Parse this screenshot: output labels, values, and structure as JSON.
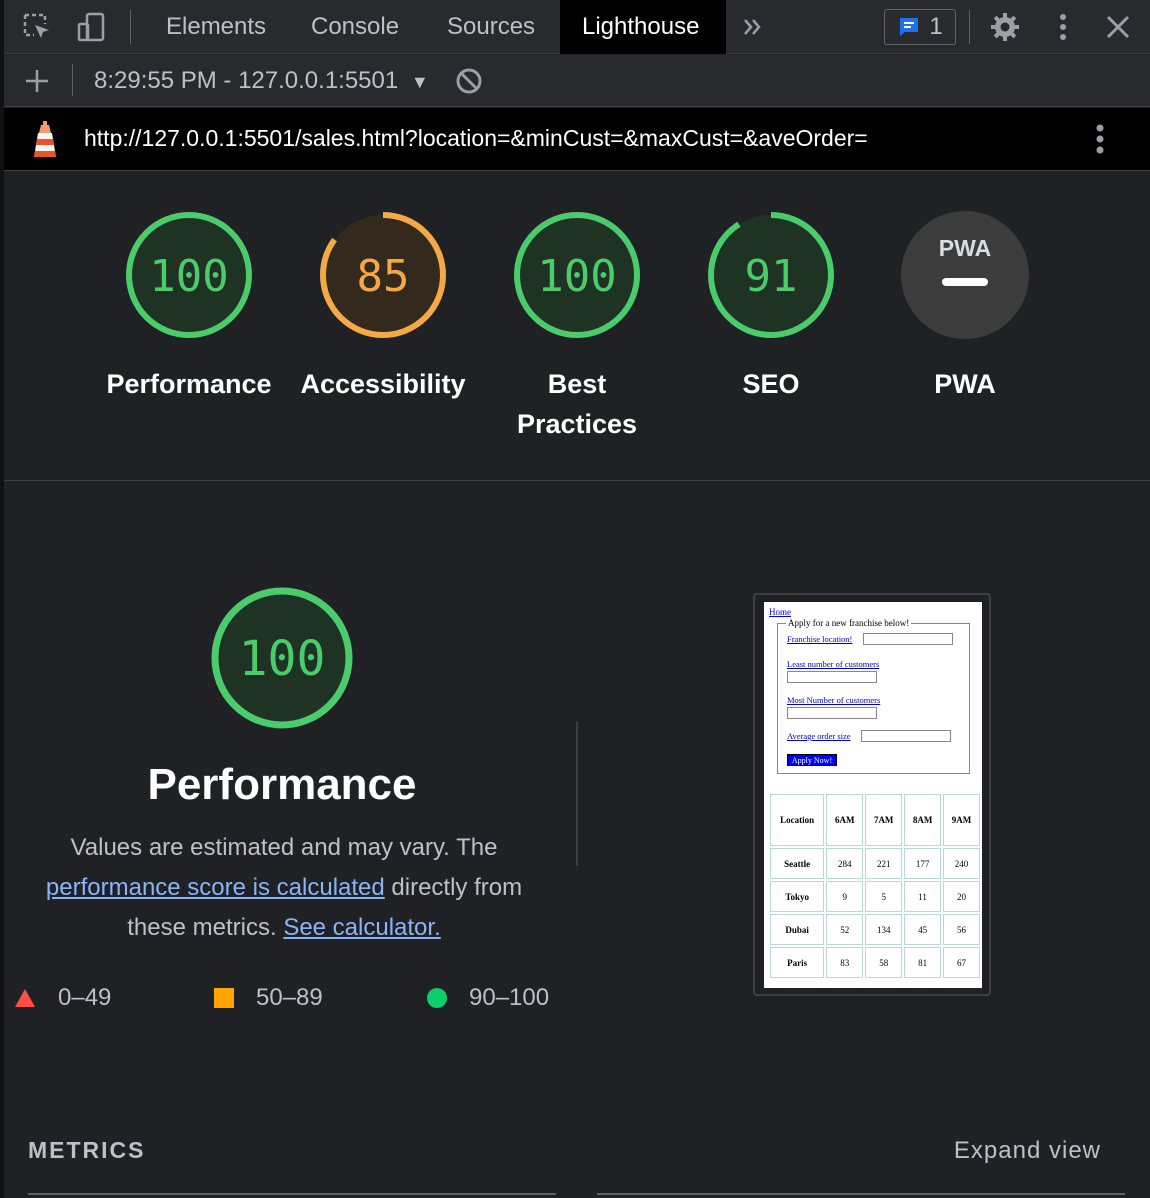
{
  "devtools": {
    "tabs": [
      "Elements",
      "Console",
      "Sources",
      "Lighthouse"
    ],
    "active_tab": "Lighthouse",
    "message_count": "1"
  },
  "report_toolbar": {
    "report_label": "8:29:55 PM - 127.0.0.1:5501"
  },
  "url_bar": {
    "url": "http://127.0.0.1:5501/sales.html?location=&minCust=&maxCust=&aveOrder="
  },
  "gauges": [
    {
      "score": "100",
      "label": "Performance",
      "value": 100,
      "color": "#4bcc6b"
    },
    {
      "score": "85",
      "label": "Accessibility",
      "value": 85,
      "color": "#f4a946"
    },
    {
      "score": "100",
      "label": "Best Practices",
      "value": 100,
      "color": "#4bcc6b"
    },
    {
      "score": "91",
      "label": "SEO",
      "value": 91,
      "color": "#4bcc6b"
    },
    {
      "score": "PWA",
      "label": "PWA",
      "value": null,
      "color": "#3c3c3c"
    }
  ],
  "performance": {
    "score": "100",
    "title": "Performance",
    "desc_before": "Values are estimated and may vary. The",
    "link1": "performance score is calculated",
    "desc_middle": "directly from these metrics.",
    "link2": "See calculator."
  },
  "legend": [
    {
      "range": "0–49",
      "color": "#ff4e42"
    },
    {
      "range": "50–89",
      "color": "#ffa400"
    },
    {
      "range": "90–100",
      "color": "#0cce6b"
    }
  ],
  "screenshot": {
    "home_link": "Home",
    "legend": "Apply for a new franchise below!",
    "fields": [
      "Franchise location!",
      "Least number of customers",
      "Most Number of customers",
      "Average order size"
    ],
    "button": "Apply Now!",
    "table_headers": [
      "Location",
      "6AM",
      "7AM",
      "8AM",
      "9AM"
    ],
    "table_rows": [
      [
        "Seattle",
        "284",
        "221",
        "177",
        "240"
      ],
      [
        "Tokyo",
        "9",
        "5",
        "11",
        "20"
      ],
      [
        "Dubai",
        "52",
        "134",
        "45",
        "56"
      ],
      [
        "Paris",
        "83",
        "58",
        "81",
        "67"
      ]
    ]
  },
  "metrics": {
    "heading": "METRICS",
    "expand": "Expand view"
  }
}
